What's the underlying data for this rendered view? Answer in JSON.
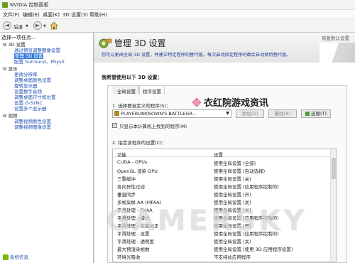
{
  "window": {
    "title": "NVIDIA 控制面板"
  },
  "menu": [
    "文件(F)",
    "编辑(E)",
    "桌面(K)",
    "3D 设置(3)",
    "帮助(H)"
  ],
  "toolbar": {
    "back_label": "后退",
    "back_glyph": "◄",
    "forward_glyph": "►",
    "dropdown_glyph": "▼"
  },
  "sidebar": {
    "header": "选择一项任务...",
    "categories": [
      {
        "label": "3D 设置",
        "items": [
          "通过预览调整图像设置",
          "管理 3D 设置",
          "配置 Surround、PhysX"
        ]
      },
      {
        "label": "显示",
        "items": [
          "更改分辨率",
          "调整桌面颜色设置",
          "旋转显示器",
          "设置数字音频",
          "调整桌面尺寸和位置",
          "设置 G-SYNC",
          "设置多个显示器"
        ]
      },
      {
        "label": "视频",
        "items": [
          "调整视频颜色设置",
          "调整视频图像设置"
        ]
      }
    ],
    "system_info": "系统信息"
  },
  "main": {
    "title": "管理 3D 设置",
    "restore_defaults": "恢复默认设置",
    "description": "您可以更改全局 3D 设置，并建立特定程序的替代值。每次启动指定程序时都会自动使用替代值。",
    "section_label": "我希望使用以下 3D 设置：",
    "tabs": [
      {
        "label": "全局设置",
        "active": false
      },
      {
        "label": "程序设置",
        "active": true
      }
    ],
    "step1_label": "1. 选择要自定义的程序(S)：",
    "program_selected": "PLAYERUNKNOWN'S BATTLEGR...",
    "add_button": "添加(D)",
    "remove_button": "删除(R)",
    "restore_button": "还原(T)",
    "show_only_found_label": "只显示本计算机上找到的程序(M)",
    "show_only_found_checked": true,
    "step2_label": "2. 指定该程序的设置(C)：",
    "table": {
      "headers": [
        "功能",
        "设置"
      ],
      "rows": [
        [
          "CUDA - GPUs",
          "使用全局设置 (全部)"
        ],
        [
          "OpenGL 渲染 GPU",
          "使用全局设置 (自动选择)"
        ],
        [
          "三重缓冲",
          "使用全局设置 (关)"
        ],
        [
          "各向异性过滤",
          "使用全局设置 (应用程序控制的)"
        ],
        [
          "垂直同步",
          "使用全局设置 (开)"
        ],
        [
          "多帧采样 AA (MFAA)",
          "使用全局设置 (关)"
        ],
        [
          "平滑处理 - FXAA",
          "使用全局设置 (关)"
        ],
        [
          "平滑处理 - 模式",
          "使用全局设置 (应用程序控制的)"
        ],
        [
          "平滑处理 - 灰度纠正",
          "使用全局设置 (开)"
        ],
        [
          "平滑处理 - 设置",
          "使用全局设置 (应用程序控制的)"
        ],
        [
          "平滑处理 - 透明度",
          "使用全局设置 (关)"
        ],
        [
          "最大预渲染帧数",
          "使用全局设置 (使用 3D 应用程序设置)"
        ],
        [
          "环境光吸收",
          "不支持此应用程序"
        ]
      ]
    }
  },
  "watermarks": {
    "site_cn": "衣红院游戏资讯",
    "site_en": "GAMERSKY"
  },
  "colors": {
    "nvidia_green": "#76b900",
    "link_blue": "#1f4fb3",
    "selected_bg": "#3a7dd8"
  }
}
